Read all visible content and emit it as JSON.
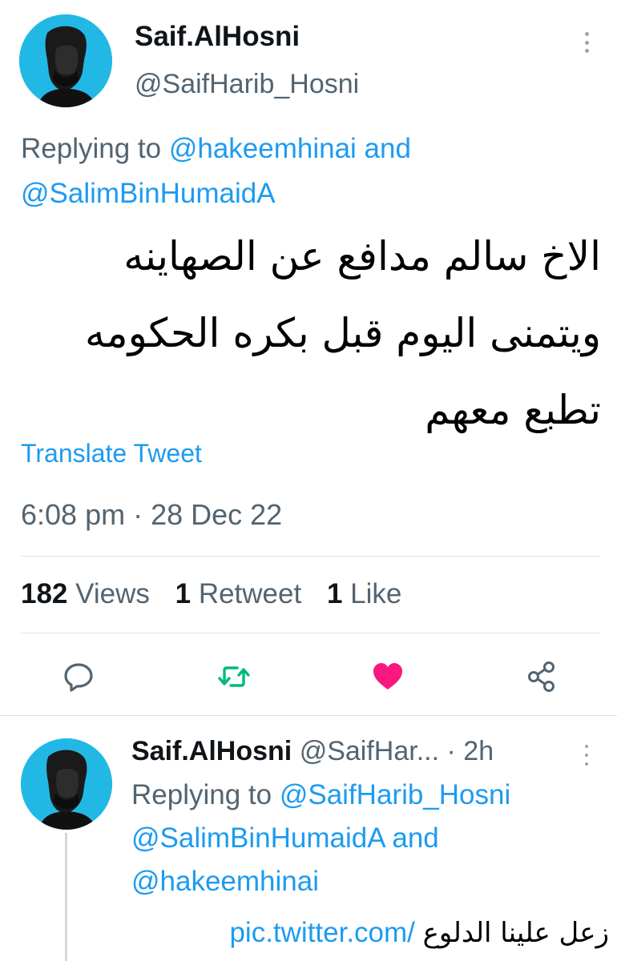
{
  "main_tweet": {
    "author_name": "Saif.AlHosni",
    "author_handle": "@SaifHarib_Hosni",
    "replying_prefix": "Replying to ",
    "replying_mention_1": "@hakeemhinai",
    "replying_and": " and",
    "replying_mention_2": "@SalimBinHumaidA",
    "text_lines": [
      "الاخ سالم مدافع عن الصهاينه",
      "ويتمنى اليوم قبل بكره الحكومه",
      "تطبع معهم"
    ],
    "translate_label": "Translate Tweet",
    "timestamp": "6:08 pm · 28 Dec 22",
    "stats": {
      "views_count": "182",
      "views_label": "Views",
      "retweets_count": "1",
      "retweets_label": "Retweet",
      "likes_count": "1",
      "likes_label": "Like"
    },
    "actions": [
      "reply-icon",
      "retweet-icon",
      "like-icon",
      "share-icon"
    ],
    "colors": {
      "accent": "#1d9bf0",
      "retweet": "#00ba7c",
      "like": "#f91880",
      "secondary_text": "#536471",
      "avatar_bg": "#22b8e6"
    }
  },
  "reply_tweet": {
    "author_name": "Saif.AlHosni",
    "author_handle": "@SaifHar...",
    "time_sep": " · ",
    "time": "2h",
    "replying_prefix": "Replying to ",
    "replying_mention_1": "@SaifHarib_Hosni",
    "replying_mention_2": "@SalimBinHumaidA",
    "replying_and": " and",
    "replying_mention_3": "@hakeemhinai",
    "link_text": "pic.twitter.com/",
    "arabic_text": "زعل علينا الدلوع"
  }
}
